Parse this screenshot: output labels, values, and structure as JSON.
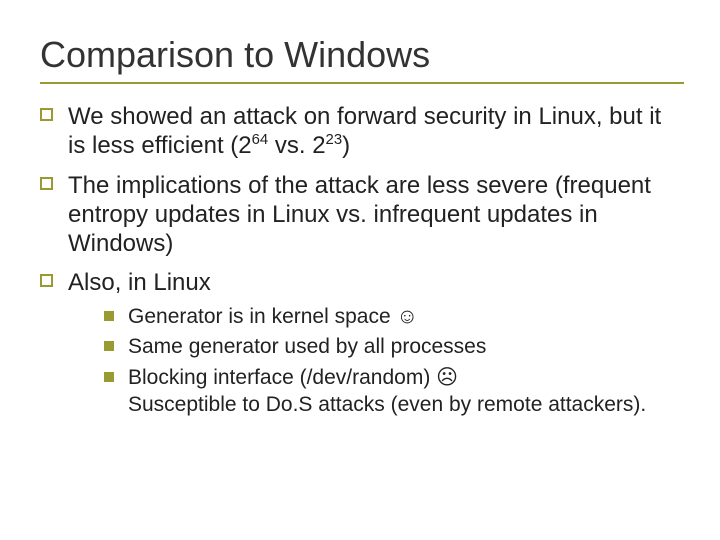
{
  "title": "Comparison to Windows",
  "bullets": {
    "b1_pre": "We showed an attack on forward security in Linux, but it is less efficient (2",
    "b1_exp1": "64",
    "b1_mid": " vs. 2",
    "b1_exp2": "23",
    "b1_post": ")",
    "b2": "The implications of the attack are less severe (frequent entropy updates in Linux vs. infrequent updates in Windows)",
    "b3": "Also, in Linux"
  },
  "sub": {
    "s1": "Generator is in kernel space ",
    "s1_face": "☺",
    "s2": "Same generator used by all processes",
    "s3a": "Blocking interface (/dev/random) ",
    "s3_face": "☹",
    "s3b": "Susceptible to Do.S attacks (even by remote attackers)."
  }
}
